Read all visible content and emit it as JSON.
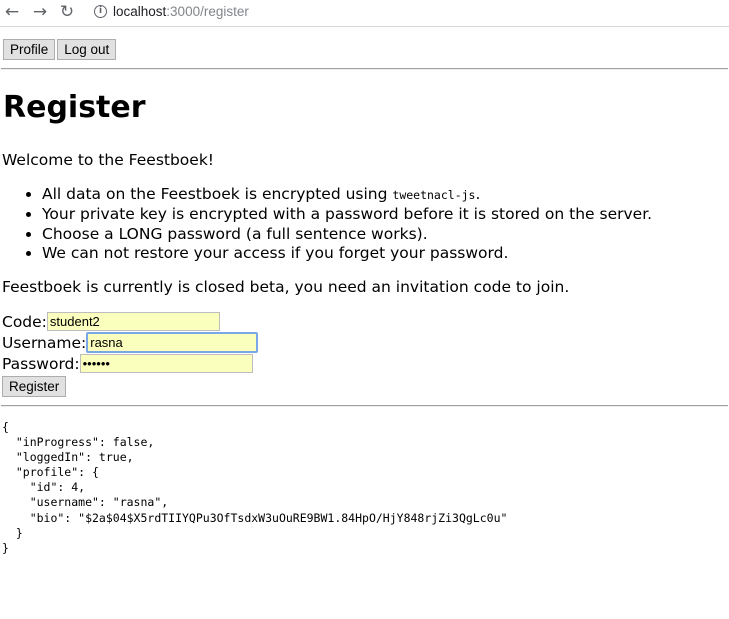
{
  "browser": {
    "back_icon": "←",
    "forward_icon": "→",
    "reload_icon": "↻",
    "url_host": "localhost",
    "url_rest": ":3000/register"
  },
  "toolbar": {
    "profile_label": "Profile",
    "logout_label": "Log out"
  },
  "page": {
    "title": "Register",
    "welcome": "Welcome to the Feestboek!",
    "list": {
      "item1_text": "All data on the Feestboek is encrypted using ",
      "item1_code": "tweetnacl-js",
      "item1_suffix": ".",
      "item2": "Your private key is encrypted with a password before it is stored on the server.",
      "item3": "Choose a LONG password (a full sentence works).",
      "item4": "We can not restore your access if you forget your password."
    },
    "beta_note": "Feestboek is currently is closed beta, you need an invitation code to join."
  },
  "form": {
    "code_label": "Code:",
    "code_value": "student2",
    "username_label": "Username:",
    "username_value": "rasna",
    "password_label": "Password:",
    "password_value": "••••••",
    "submit_label": "Register"
  },
  "state_json": "{\n  \"inProgress\": false,\n  \"loggedIn\": true,\n  \"profile\": {\n    \"id\": 4,\n    \"username\": \"rasna\",\n    \"bio\": \"$2a$04$X5rdTIIYQPu3OfTsdxW3uOuRE9BW1.84HpO/HjY848rjZi3QgLc0u\"\n  }\n}"
}
